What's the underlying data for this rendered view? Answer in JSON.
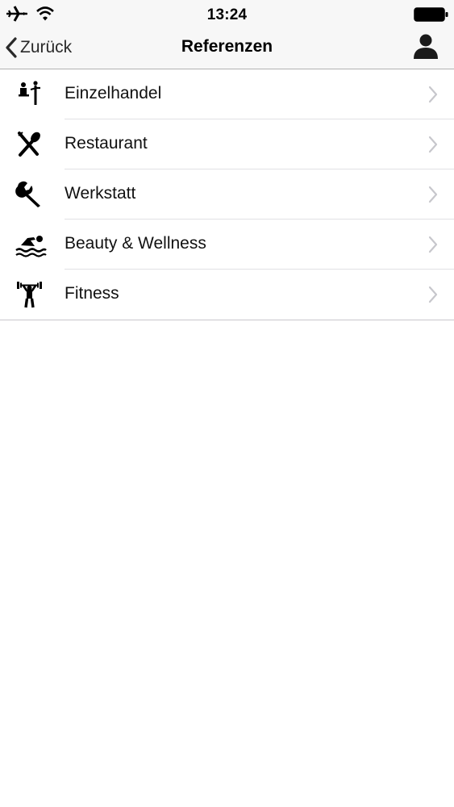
{
  "status_bar": {
    "time": "13:24",
    "icons": [
      "airplane-icon",
      "wifi-icon",
      "battery-icon"
    ]
  },
  "nav": {
    "back_label": "Zurück",
    "title": "Referenzen",
    "right_icon": "person-icon"
  },
  "list": {
    "items": [
      {
        "label": "Einzelhandel",
        "icon": "retail-icon"
      },
      {
        "label": "Restaurant",
        "icon": "fork-knife-icon"
      },
      {
        "label": "Werkstatt",
        "icon": "wrench-icon"
      },
      {
        "label": "Beauty & Wellness",
        "icon": "swimmer-icon"
      },
      {
        "label": "Fitness",
        "icon": "weightlifter-icon"
      }
    ]
  }
}
